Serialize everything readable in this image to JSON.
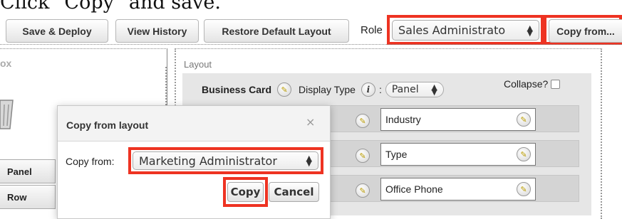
{
  "caption": "Click \"Copy\" and save.",
  "toolbar": {
    "save_deploy": "Save & Deploy",
    "view_history": "View History",
    "restore_default": "Restore Default Layout",
    "role_label": "Role",
    "role_value": "Sales Administrato",
    "copy_from": "Copy from..."
  },
  "toolbox": {
    "title": "ox",
    "items": [
      "Panel",
      "Row"
    ]
  },
  "layout": {
    "title": "Layout",
    "panel_name": "Business Card",
    "display_type_label": "Display Type",
    "info_glyph": "i",
    "display_type_colon": ":",
    "display_type_value": "Panel",
    "collapse_label": "Collapse?",
    "fields": [
      "Industry",
      "Type",
      "Office Phone"
    ]
  },
  "modal": {
    "title": "Copy from layout",
    "close_glyph": "×",
    "copy_from_label": "Copy from:",
    "copy_from_value": "Marketing Administrator",
    "copy_button": "Copy",
    "cancel_button": "Cancel"
  },
  "colors": {
    "highlight": "#ee3322",
    "layout_bg": "#e6e6e6"
  },
  "icons": {
    "pencil": "pencil-icon",
    "info": "info-icon",
    "select_arrows": "updown-arrows-icon",
    "close": "close-icon",
    "trash": "trash-icon"
  }
}
